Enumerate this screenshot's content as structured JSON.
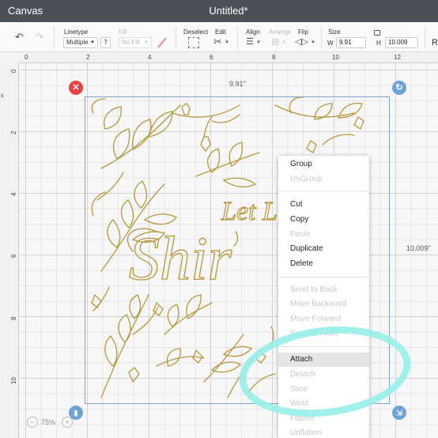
{
  "titlebar": {
    "app_name": "Canvas",
    "document_title": "Untitled*"
  },
  "toolbar": {
    "linetype_label": "Linetype",
    "linetype_value": "Multiple",
    "linetype_help": "?",
    "fill_label": "Fill",
    "fill_value": "No Fill",
    "deselect_label": "Deselect",
    "edit_label": "Edit",
    "align_label": "Align",
    "arrange_label": "Arrange",
    "flip_label": "Flip",
    "size_label": "Size",
    "width_prefix": "W",
    "width_value": "9.91",
    "height_prefix": "H",
    "height_value": "10.009",
    "rotate_prefix": "R"
  },
  "rulers": {
    "top_ticks": [
      "0",
      "2",
      "4",
      "6",
      "8",
      "10",
      "12"
    ],
    "left_ticks": [
      "0",
      "2",
      "4",
      "6",
      "8",
      "10"
    ],
    "left_cut": "s"
  },
  "selection": {
    "width_label": "9.91\"",
    "height_label": "10.009\""
  },
  "design_text": {
    "line1": "Let L",
    "line2": "Shir"
  },
  "zoom": {
    "minus": "−",
    "value": "75%",
    "plus": "+"
  },
  "context_menu": {
    "items": [
      {
        "label": "Group",
        "enabled": true
      },
      {
        "label": "UnGroup",
        "enabled": false
      },
      {
        "label": "Cut",
        "enabled": true
      },
      {
        "label": "Copy",
        "enabled": true
      },
      {
        "label": "Paste",
        "enabled": false
      },
      {
        "label": "Duplicate",
        "enabled": true
      },
      {
        "label": "Delete",
        "enabled": true
      },
      {
        "label": "Send to Back",
        "enabled": false
      },
      {
        "label": "Move Backward",
        "enabled": false
      },
      {
        "label": "Move Forward",
        "enabled": false
      },
      {
        "label": "Send to Front",
        "enabled": false
      },
      {
        "label": "Attach",
        "enabled": true,
        "highlighted": true
      },
      {
        "label": "Detach",
        "enabled": false
      },
      {
        "label": "Slice",
        "enabled": false
      },
      {
        "label": "Weld",
        "enabled": false
      },
      {
        "label": "Flatten",
        "enabled": false
      },
      {
        "label": "Unflatten",
        "enabled": false
      }
    ]
  },
  "colors": {
    "accent_highlight": "#97efe9",
    "design_gold": "#b8973a",
    "close_red": "#e84343",
    "handle_blue": "#6ea3d8"
  }
}
